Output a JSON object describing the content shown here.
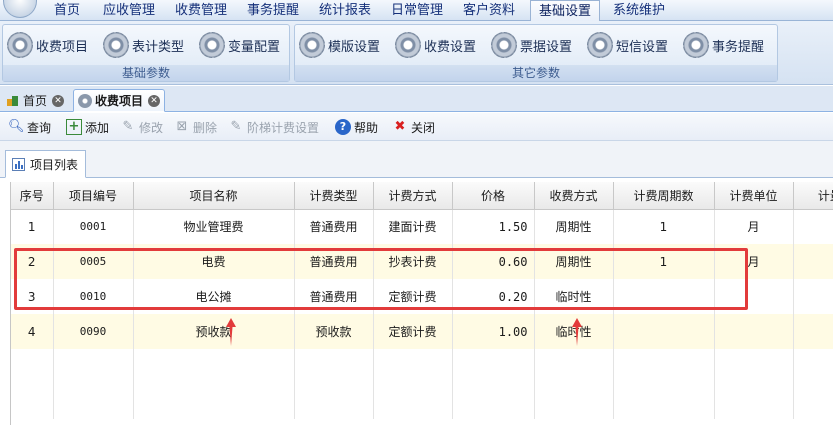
{
  "menu": {
    "items": [
      "首页",
      "应收管理",
      "收费管理",
      "事务提醒",
      "统计报表",
      "日常管理",
      "客户资料",
      "基础设置",
      "系统维护"
    ],
    "active_index": 7
  },
  "ribbon": {
    "group1": {
      "title": "基础参数",
      "buttons": [
        "收费项目",
        "表计类型",
        "变量配置"
      ]
    },
    "group2": {
      "title": "其它参数",
      "buttons": [
        "模版设置",
        "收费设置",
        "票据设置",
        "短信设置",
        "事务提醒"
      ]
    }
  },
  "doc_tabs": {
    "home": "首页",
    "fee_items": "收费项目"
  },
  "toolbar": {
    "query": "查询",
    "add": "添加",
    "edit": "修改",
    "delete": "删除",
    "tiered": "阶梯计费设置",
    "help": "帮助",
    "close": "关闭"
  },
  "panel": {
    "list_tab": "项目列表"
  },
  "table": {
    "headers": [
      "序号",
      "项目编号",
      "项目名称",
      "计费类型",
      "计费方式",
      "价格",
      "收费方式",
      "计费周期数",
      "计费单位",
      "计量-"
    ],
    "rows": [
      [
        "1",
        "0001",
        "物业管理费",
        "普通费用",
        "建面计费",
        "1.50",
        "周期性",
        "1",
        "月",
        ""
      ],
      [
        "2",
        "0005",
        "电费",
        "普通费用",
        "抄表计费",
        "0.60",
        "周期性",
        "1",
        "月",
        ""
      ],
      [
        "3",
        "0010",
        "电公摊",
        "普通费用",
        "定额计费",
        "0.20",
        "临时性",
        "",
        "",
        ""
      ],
      [
        "4",
        "0090",
        "预收款",
        "预收款",
        "定额计费",
        "1.00",
        "临时性",
        "",
        "",
        ""
      ]
    ]
  },
  "colors": {
    "annotation_red": "#e23b3b",
    "accent_blue": "#15307a",
    "row_alt": "#fffbe4"
  }
}
